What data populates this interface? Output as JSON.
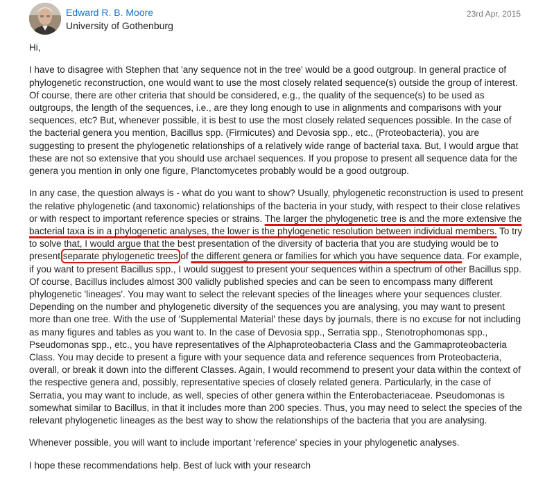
{
  "post": {
    "author": {
      "name": "Edward R. B. Moore",
      "affiliation": "University of Gothenburg",
      "avatar_icon": "user-avatar-photo"
    },
    "date": "23rd Apr, 2015",
    "greeting": "Hi,",
    "p1": "I have to disagree with Stephen that 'any sequence not in the tree' would be a good outgroup. In general practice of phylogenetic reconstruction, one would want to use the most closely related sequence(s) outside the group of interest. Of course, there are other criteria that should be considered, e.g., the quality of the sequence(s) to be used as outgroups, the length of the sequences, i.e., are they long enough to use in alignments and comparisons with your sequences, etc? But, whenever possible, it is best to use the most closely related sequences possible. In the case of the bacterial genera you mention, Bacillus spp. (Firmicutes) and Devosia spp., etc., (Proteobacteria), you are suggesting to present the phylogenetic relationships of a relatively wide range of bacterial taxa. But, I would argue that these are not so extensive that you should use archael sequences. If you propose to present all sequence data for the genera you mention in only one figure, Planctomycetes probably would be a good outgroup.",
    "p2_a": "In any case, the question always is - what do you want to show? Usually, phylogenetic reconstruction is used to present the relative phylogenetic (and taxonomic) relationships of the bacteria in your study, with respect to their close relatives or with respect to important reference species or strains. ",
    "p2_underline1": "The larger the phylogenetic tree is and the more extensive the bacterial taxa is in a phylogenetic analyses, the lower is the phylogenetic resolution between individual members.",
    "p2_b": " To try to solve that, I would argue that the best presentation of the diversity of bacteria that you are studying would be to present ",
    "p2_boxed": "separate phylogenetic trees",
    "p2_c": " of ",
    "p2_underline2": "the different genera or families for which you have sequence data",
    "p2_d": ". For example, if you want to present Bacillus spp., I would suggest to present your sequences within a spectrum of other Bacillus spp. Of course, Bacillus includes almost 300 validly published species and can be seen to encompass many different phylogenetic 'lineages'. You may want to select the relevant species of the lineages where your sequences cluster. Depending on the number and phylogenetic diversity of the sequences you are analysing, you may want to present more than one tree. With the use of 'Supplemental Material' these days by journals, there is no excuse for not including as many figures and tables as you want to. In the case of Devosia spp., Serratia spp., Stenotrophomonas spp., Pseudomonas spp., etc., you have representatives of the Alphaproteobacteria Class and the Gammaproteobacteria Class. You may decide to present a figure with your sequence data and reference sequences from Proteobacteria, overall, or break it down into the different Classes. Again, I would recommend to present your data within the context of the respective genera and, possibly, representative species of closely related genera. Particularly, in the case of Serratia, you may want to include, as well, species of other genera within the Enterobacteriaceae. Pseudomonas is somewhat similar to Bacillus, in that it includes more than 200 species. Thus, you may need to select the species of the relevant phylogenetic lineages as the best way to show the relationships of the bacteria that you are analysing.",
    "p3": "Whenever possible, you will want to include important 'reference' species in your phylogenetic analyses.",
    "p4": "I hope these recommendations help. Best of luck with your research",
    "annotation_color": "#e01010",
    "link_color": "#1a73c8"
  }
}
